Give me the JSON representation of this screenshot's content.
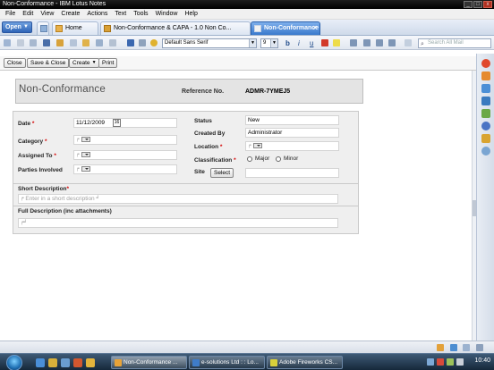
{
  "window": {
    "title": "Non-Conformance - IBM Lotus Notes"
  },
  "menu": [
    "File",
    "Edit",
    "View",
    "Create",
    "Actions",
    "Text",
    "Tools",
    "Window",
    "Help"
  ],
  "tabs": {
    "open_label": "Open",
    "home": "Home",
    "tab2": "Non-Conformance & CAPA - 1.0 Non Co...",
    "tab3": "Non-Conformance"
  },
  "toolbar": {
    "font_name": "Default Sans Serif",
    "font_size": "9",
    "search_placeholder": "Search All Mail",
    "format_bold": "b",
    "format_italic": "i",
    "format_underline": "u"
  },
  "actions": {
    "close": "Close",
    "save_close": "Save & Close",
    "create": "Create",
    "print": "Print"
  },
  "document": {
    "title": "Non-Conformance",
    "reference_label": "Reference No.",
    "reference_value": "ADMR-7YMEJ5"
  },
  "form": {
    "date_label": "Date",
    "date_value": "11/12/2009",
    "calendar_glyph": "16",
    "category_label": "Category",
    "assigned_label": "Assigned To",
    "parties_label": "Parties Involved",
    "status_label": "Status",
    "status_value": "New",
    "created_label": "Created By",
    "created_value": "Administrator",
    "location_label": "Location",
    "classification_label": "Classification",
    "major_label": "Major",
    "minor_label": "Minor",
    "site_label": "Site",
    "select_label": "Select",
    "short_desc_label": "Short Description",
    "short_desc_placeholder": "Enter in a short description",
    "full_desc_label": "Full Description (inc attachments)",
    "required_mark": "*",
    "field_caret": "╒",
    "field_close_mark": "╛"
  },
  "taskbar": {
    "task1": "Non-Conformance ...",
    "task2": "e-solutions Ltd : : Lo...",
    "task3": "Adobe Fireworks CS...",
    "clock": "10:40"
  },
  "colors": {
    "accent": "#2f65b8",
    "required": "#d40000"
  }
}
